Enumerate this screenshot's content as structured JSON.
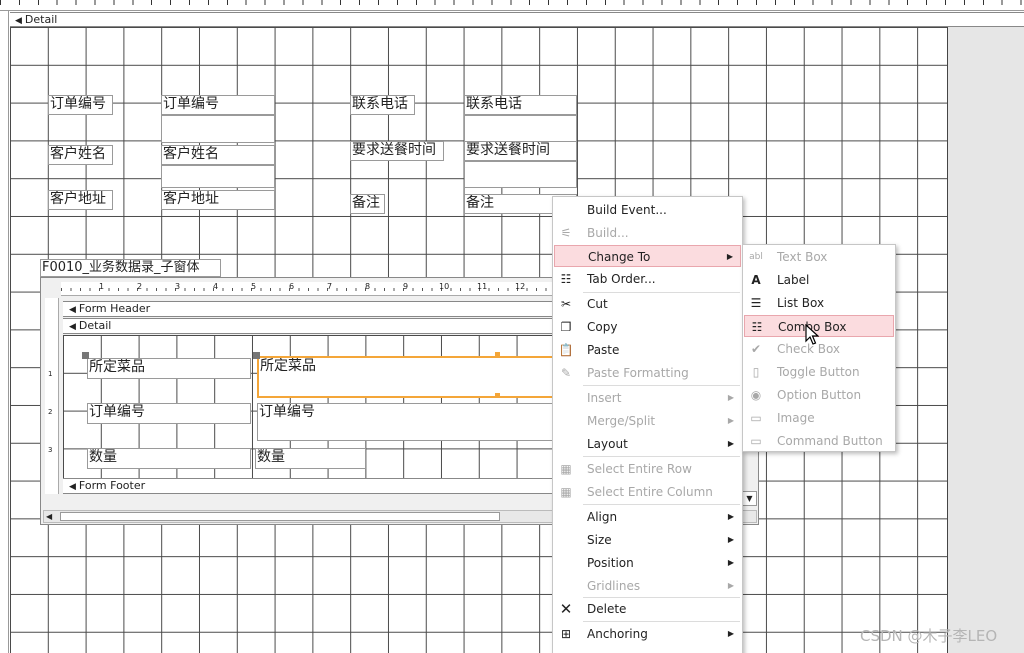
{
  "detail_bar": "Detail",
  "main_fields": [
    {
      "text": "订单编号"
    },
    {
      "text": "订单编号"
    },
    {
      "text": "联系电话"
    },
    {
      "text": "联系电话"
    },
    {
      "text": "客户姓名"
    },
    {
      "text": "客户姓名"
    },
    {
      "text": "要求送餐时间"
    },
    {
      "text": "要求送餐时间"
    },
    {
      "text": "客户地址"
    },
    {
      "text": "客户地址"
    },
    {
      "text": "备注"
    },
    {
      "text": "备注"
    }
  ],
  "subform_label": "F0010_业务数据录_子窗体",
  "subform": {
    "ruler_nums": [
      "1",
      "2",
      "3",
      "4",
      "5",
      "6",
      "7",
      "8",
      "9",
      "10",
      "11",
      "12"
    ],
    "vruler_nums": [
      "1",
      "2",
      "3"
    ],
    "form_header": "Form Header",
    "detail": "Detail",
    "form_footer": "Form Footer",
    "fields": [
      {
        "text": "所定菜品"
      },
      {
        "text": "所定菜品"
      },
      {
        "text": "订单编号"
      },
      {
        "text": "订单编号"
      },
      {
        "text": "数量"
      },
      {
        "text": "数量"
      }
    ]
  },
  "context_menu": {
    "items": [
      {
        "label": "Build Event...",
        "icon": "none",
        "disabled": false,
        "submenu": false
      },
      {
        "label": "Build...",
        "icon": "wand-icon",
        "disabled": true,
        "submenu": false
      },
      {
        "label": "Change To",
        "icon": "none",
        "disabled": false,
        "submenu": true
      },
      {
        "label": "Tab Order...",
        "icon": "tab-order-icon",
        "disabled": false,
        "submenu": false
      },
      {
        "label": "Cut",
        "icon": "scissors-icon",
        "disabled": false,
        "submenu": false
      },
      {
        "label": "Copy",
        "icon": "copy-icon",
        "disabled": false,
        "submenu": false
      },
      {
        "label": "Paste",
        "icon": "clipboard-icon",
        "disabled": false,
        "submenu": false
      },
      {
        "label": "Paste Formatting",
        "icon": "paste-formatting-icon",
        "disabled": true,
        "submenu": false
      },
      {
        "label": "Insert",
        "icon": "none",
        "disabled": true,
        "submenu": true
      },
      {
        "label": "Merge/Split",
        "icon": "none",
        "disabled": true,
        "submenu": true
      },
      {
        "label": "Layout",
        "icon": "none",
        "disabled": false,
        "submenu": true
      },
      {
        "label": "Select Entire Row",
        "icon": "table-row-icon",
        "disabled": true,
        "submenu": false
      },
      {
        "label": "Select Entire Column",
        "icon": "table-column-icon",
        "disabled": true,
        "submenu": false
      },
      {
        "label": "Align",
        "icon": "none",
        "disabled": false,
        "submenu": true
      },
      {
        "label": "Size",
        "icon": "none",
        "disabled": false,
        "submenu": true
      },
      {
        "label": "Position",
        "icon": "none",
        "disabled": false,
        "submenu": true
      },
      {
        "label": "Gridlines",
        "icon": "none",
        "disabled": true,
        "submenu": true
      },
      {
        "label": "Delete",
        "icon": "delete-x-icon",
        "disabled": false,
        "submenu": false
      },
      {
        "label": "Anchoring",
        "icon": "anchoring-icon",
        "disabled": false,
        "submenu": true
      }
    ]
  },
  "submenu": {
    "items": [
      {
        "label": "Text Box",
        "icon": "textbox-icon",
        "disabled": true
      },
      {
        "label": "Label",
        "icon": "label-icon",
        "disabled": false
      },
      {
        "label": "List Box",
        "icon": "listbox-icon",
        "disabled": false
      },
      {
        "label": "Combo Box",
        "icon": "combobox-icon",
        "disabled": false
      },
      {
        "label": "Check Box",
        "icon": "checkbox-icon",
        "disabled": true
      },
      {
        "label": "Toggle Button",
        "icon": "toggle-icon",
        "disabled": true
      },
      {
        "label": "Option Button",
        "icon": "radio-icon",
        "disabled": true
      },
      {
        "label": "Image",
        "icon": "image-icon",
        "disabled": true
      },
      {
        "label": "Command Button",
        "icon": "button-icon",
        "disabled": true
      }
    ]
  },
  "watermark": "CSDN @木子李LEO",
  "colors": {
    "highlight": "#fbdcdf",
    "selection": "#f4a639",
    "gridline": "#4a4a4a",
    "side_gray": "#e6e6e6"
  }
}
